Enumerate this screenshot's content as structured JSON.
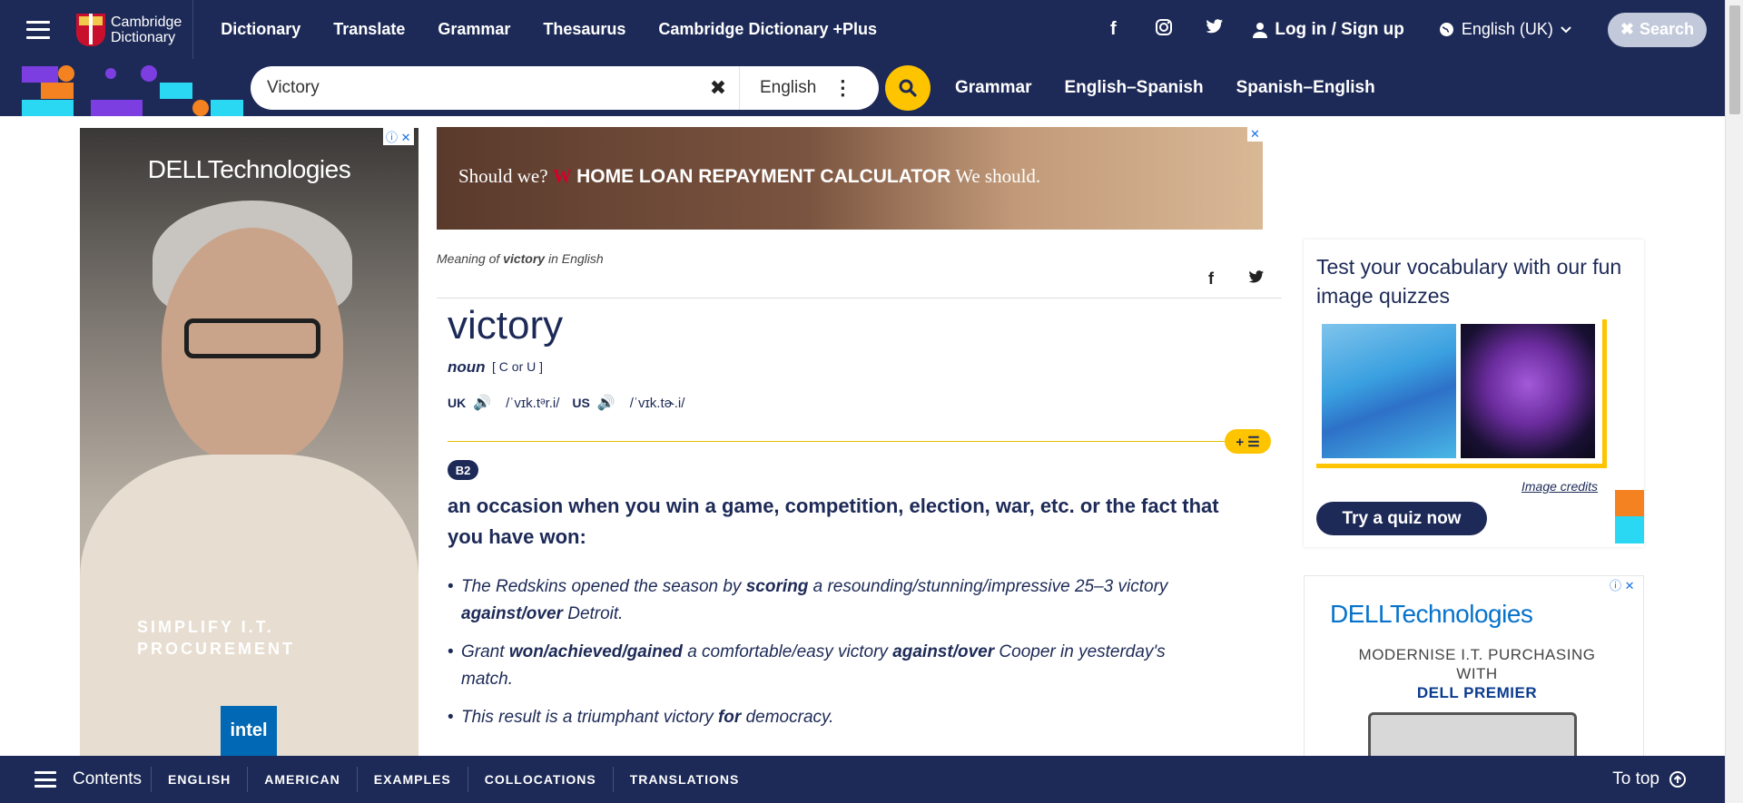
{
  "header": {
    "logo_text_line1": "Cambridge",
    "logo_text_line2": "Dictionary",
    "nav": [
      "Dictionary",
      "Translate",
      "Grammar",
      "Thesaurus",
      "Cambridge Dictionary +Plus"
    ],
    "login": "Log in / Sign up",
    "language": "English (UK)",
    "search_button": "Search"
  },
  "search": {
    "value": "Victory",
    "dictionary": "English",
    "quick_links": [
      "Grammar",
      "English–Spanish",
      "Spanish–English"
    ]
  },
  "ads": {
    "left": {
      "brand": "DELLTechnologies",
      "copy_line1": "SIMPLIFY I.T.",
      "copy_line2": "PROCUREMENT",
      "partner": "intel"
    },
    "top": {
      "text_before": "Should we?",
      "brand_mark": "W",
      "headline": "HOME LOAN REPAYMENT CALCULATOR",
      "text_after": "We should."
    },
    "right": {
      "brand": "DELLTechnologies",
      "copy_line1": "MODERNISE I.T. PURCHASING",
      "copy_line2": "WITH",
      "copy_line3": "DELL PREMIER"
    }
  },
  "entry": {
    "meaning_prefix": "Meaning of",
    "meaning_word": "victory",
    "meaning_suffix": "in English",
    "headword": "victory",
    "pos": "noun",
    "grammar": "[ C or U ]",
    "uk_label": "UK",
    "uk_ipa": "/ˈvɪk.tᵊr.i/",
    "us_label": "US",
    "us_ipa": "/ˈvɪk.tɚ.i/",
    "level": "B2",
    "definition": "an occasion when you win a game, competition, election, war, etc. or the fact that you have won:",
    "examples": [
      {
        "parts": [
          "The Redskins opened the season by ",
          "scoring",
          " a resounding/stunning/impressive 25–3 victory ",
          "against/over",
          " Detroit."
        ]
      },
      {
        "parts": [
          "Grant ",
          "won/achieved/gained",
          " a comfortable/easy victory ",
          "against/over",
          " Cooper in yesterday's match."
        ]
      },
      {
        "parts": [
          "This result is a triumphant victory ",
          "for",
          " democracy.",
          "",
          ""
        ]
      }
    ]
  },
  "quiz": {
    "title": "Test your vocabulary with our fun image quizzes",
    "credits": "Image credits",
    "button": "Try a quiz now"
  },
  "bottom": {
    "contents": "Contents",
    "tabs": [
      "ENGLISH",
      "AMERICAN",
      "EXAMPLES",
      "COLLOCATIONS",
      "TRANSLATIONS"
    ],
    "to_top": "To top"
  },
  "colors": {
    "navy": "#1d2a57",
    "yellow": "#fec400"
  }
}
